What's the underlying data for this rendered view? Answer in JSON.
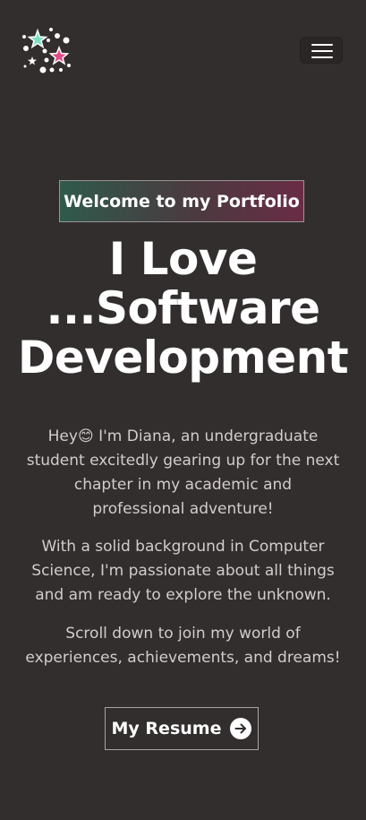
{
  "header": {
    "logo_icon": "stars-logo-icon",
    "menu_icon": "hamburger-menu-icon"
  },
  "hero": {
    "badge": "Welcome to my Portfolio",
    "headline_line1": "I Love",
    "headline_line2": "...Software",
    "headline_line3": "Development",
    "intro_hey": "Hey",
    "intro_emoji": "😊",
    "intro_line1_rest": " I'm Diana, an undergraduate",
    "intro_line2": "student excitedly gearing up for the next",
    "intro_line3": "chapter in my academic and",
    "intro_line4": "professional adventure!",
    "bg_line1": "With a solid background in Computer",
    "bg_line2": "Science, I'm passionate about all things",
    "bg_line3": "and am ready to explore the unknown.",
    "scroll_line1": "Scroll down to join my world of",
    "scroll_line2": "experiences, achievements, and dreams!",
    "resume_button": "My Resume",
    "resume_icon": "arrow-right-circle-icon"
  },
  "colors": {
    "background": "#332e2e",
    "badge_gradient_start": "#2f5a4c",
    "badge_gradient_end": "#6a2c45",
    "body_text": "#d2cccc"
  }
}
